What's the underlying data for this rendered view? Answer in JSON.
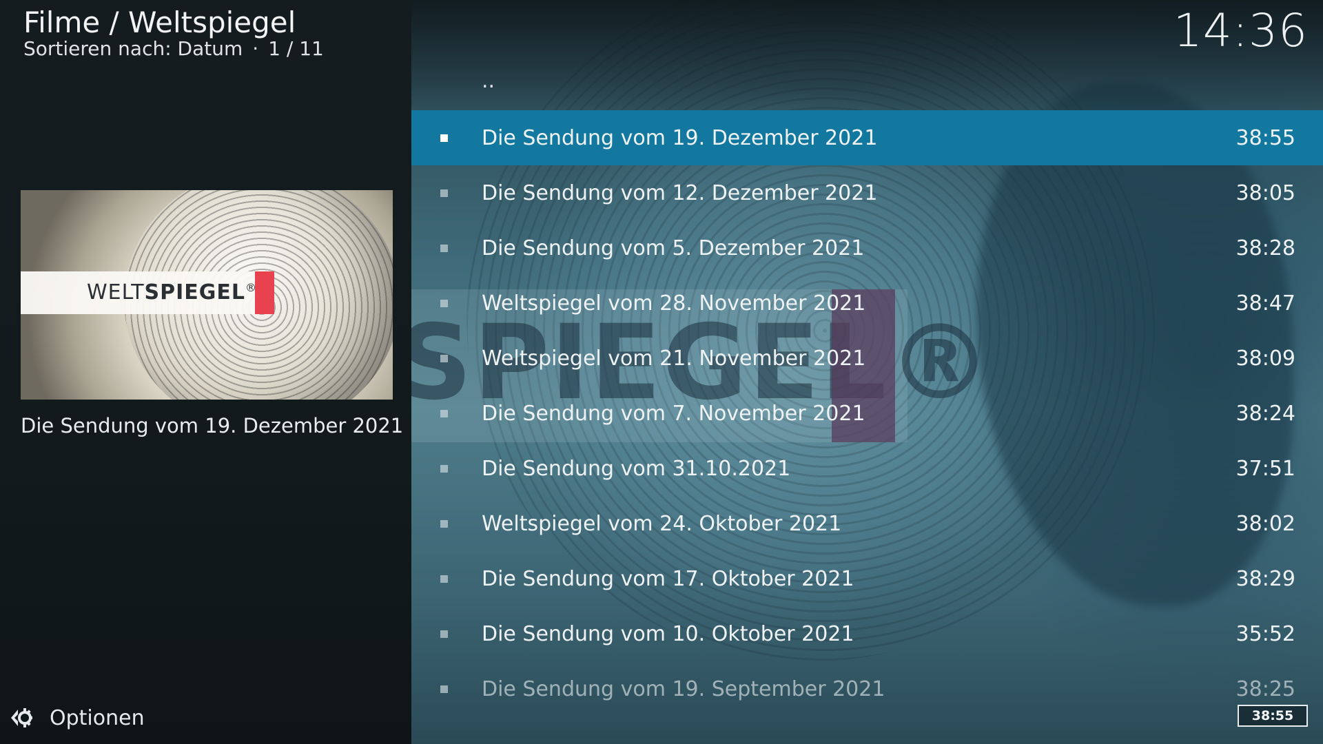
{
  "header": {
    "title": "Filme / Weltspiegel",
    "sort_label": "Sortieren nach: Datum",
    "separator": "·",
    "position": "1 / 11"
  },
  "clock": "14:36",
  "thumbnail": {
    "logo_regular": "WELT",
    "logo_bold": "SPIEGEL",
    "logo_mark": "®"
  },
  "selected_title": "Die Sendung vom 19. Dezember 2021",
  "options": {
    "label": "Optionen",
    "icon": "options-gear-arrow-icon"
  },
  "list": {
    "parent_label": "..",
    "items": [
      {
        "title": "Die Sendung vom 19. Dezember 2021",
        "duration": "38:55"
      },
      {
        "title": "Die Sendung vom 12. Dezember 2021",
        "duration": "38:05"
      },
      {
        "title": "Die Sendung vom 5. Dezember 2021",
        "duration": "38:28"
      },
      {
        "title": "Weltspiegel vom 28. November 2021",
        "duration": "38:47"
      },
      {
        "title": "Weltspiegel vom 21. November 2021",
        "duration": "38:09"
      },
      {
        "title": "Die Sendung vom 7. November 2021",
        "duration": "38:24"
      },
      {
        "title": "Die Sendung vom 31.10.2021",
        "duration": "37:51"
      },
      {
        "title": "Weltspiegel vom 24. Oktober 2021",
        "duration": "38:02"
      },
      {
        "title": "Die Sendung vom 17. Oktober 2021",
        "duration": "38:29"
      },
      {
        "title": "Die Sendung vom 10. Oktober 2021",
        "duration": "35:52"
      },
      {
        "title": "Die Sendung vom 19. September 2021",
        "duration": "38:25"
      }
    ]
  },
  "duration_badge": "38:55",
  "colors": {
    "selection": "#12789f",
    "accent_red": "#e8424f"
  }
}
